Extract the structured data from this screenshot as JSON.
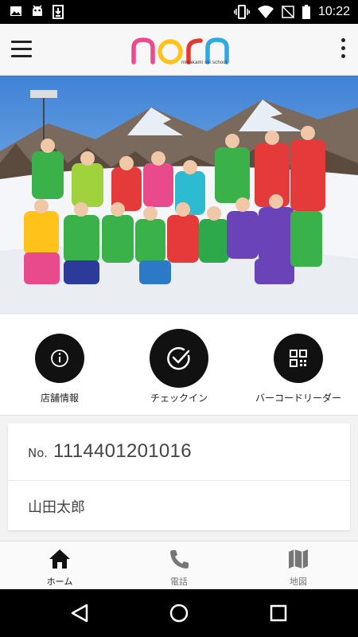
{
  "status_bar": {
    "time": "10:22",
    "left_icons": [
      "image-icon",
      "android-icon",
      "download-icon"
    ],
    "right_icons": [
      "vibrate-icon",
      "wifi-icon",
      "no-sim-icon",
      "battery-icon"
    ]
  },
  "app_bar": {
    "logo_text": "norn",
    "logo_subtitle": "minakami ski school",
    "logo_colors": [
      "#ee4a8b",
      "#ffc21a",
      "#e9372f",
      "#2fa9e0"
    ]
  },
  "hero": {
    "alt": "スキースクールの集合写真"
  },
  "actions": [
    {
      "label": "店舗情報",
      "icon": "info-icon"
    },
    {
      "label": "チェックイン",
      "icon": "check-icon"
    },
    {
      "label": "バーコードリーダー",
      "icon": "qr-code-icon"
    }
  ],
  "member": {
    "number_prefix": "No.",
    "number": "1114401201016",
    "name": "山田太郎"
  },
  "bottom_nav": [
    {
      "label": "ホーム",
      "icon": "home-icon",
      "active": true
    },
    {
      "label": "電話",
      "icon": "phone-icon",
      "active": false
    },
    {
      "label": "地図",
      "icon": "map-icon",
      "active": false
    }
  ],
  "colors": {
    "active_nav": "#111111",
    "inactive_nav": "#777777"
  }
}
